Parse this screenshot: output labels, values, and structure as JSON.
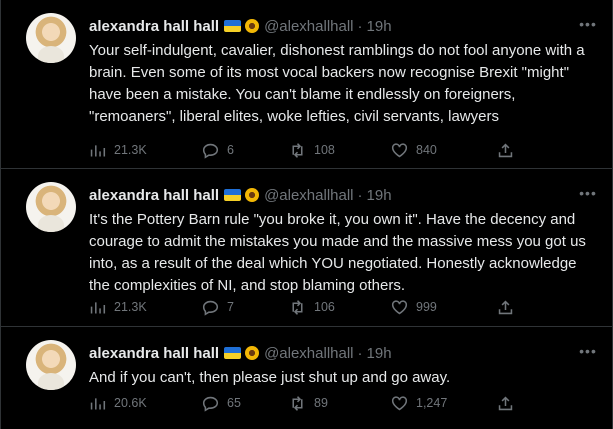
{
  "tweets": [
    {
      "name": "alexandra hall hall",
      "handle": "@alexhallhall",
      "separator": "·",
      "time": "19h",
      "text": "Your self-indulgent, cavalier, dishonest ramblings do not fool anyone with a brain. Even some of its most vocal backers now recognise Brexit \"might\" have been a mistake. You can't blame it endlessly on foreigners, \"remoaners\", liberal elites, woke lefties, civil servants, lawyers",
      "views": "21.3K",
      "replies": "6",
      "retweets": "108",
      "likes": "840"
    },
    {
      "name": "alexandra hall hall",
      "handle": "@alexhallhall",
      "separator": "·",
      "time": "19h",
      "text": "It's the Pottery Barn rule \"you broke it, you own it\". Have the decency and courage to admit the mistakes you made and the massive mess you got us into, as a result of the deal which YOU negotiated. Honestly  acknowledge the complexities of NI, and stop blaming others.",
      "views": "21.3K",
      "replies": "7",
      "retweets": "106",
      "likes": "999"
    },
    {
      "name": "alexandra hall hall",
      "handle": "@alexhallhall",
      "separator": "·",
      "time": "19h",
      "text": "And if you can't, then please just shut up and go away.",
      "views": "20.6K",
      "replies": "65",
      "retweets": "89",
      "likes": "1,247"
    }
  ],
  "icons": {
    "flag": "ukraine-flag-icon",
    "flower": "sunflower-icon",
    "more": "more-icon",
    "views": "views-icon",
    "reply": "reply-icon",
    "retweet": "retweet-icon",
    "like": "like-icon",
    "share": "share-icon"
  },
  "colors": {
    "background": "#000000",
    "text": "#e7e9ea",
    "muted": "#71767b",
    "border": "#2f3336"
  }
}
